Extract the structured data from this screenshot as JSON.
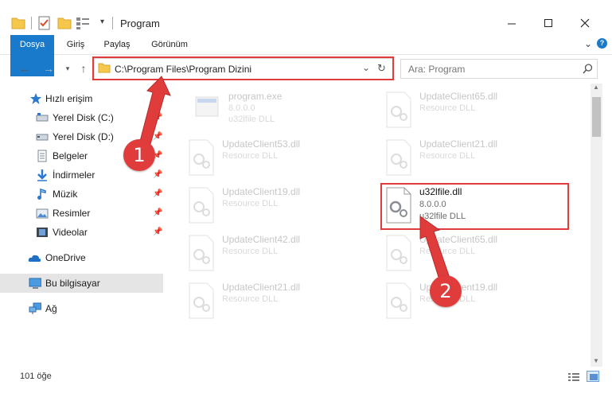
{
  "window": {
    "title": "Program"
  },
  "ribbon": {
    "tabs": [
      "Dosya",
      "Giriş",
      "Paylaş",
      "Görünüm"
    ]
  },
  "address": {
    "path": "C:\\Program Files\\Program Dizini"
  },
  "search": {
    "placeholder": "Ara: Program"
  },
  "sidebar": {
    "items": [
      {
        "label": "Hızlı erişim",
        "icon": "star-icon"
      },
      {
        "label": "Yerel Disk (C:)",
        "icon": "drive-icon"
      },
      {
        "label": "Yerel Disk (D:)",
        "icon": "drive-icon"
      },
      {
        "label": "Belgeler",
        "icon": "documents-icon"
      },
      {
        "label": "İndirmeler",
        "icon": "download-icon"
      },
      {
        "label": "Müzik",
        "icon": "music-icon"
      },
      {
        "label": "Resimler",
        "icon": "pictures-icon"
      },
      {
        "label": "Videolar",
        "icon": "videos-icon"
      },
      {
        "label": "OneDrive",
        "icon": "cloud-icon"
      },
      {
        "label": "Bu bilgisayar",
        "icon": "computer-icon"
      },
      {
        "label": "Ağ",
        "icon": "network-icon"
      }
    ]
  },
  "files": [
    {
      "name": "program.exe",
      "line2": "8.0.0.0",
      "line3": "u32lfile DLL",
      "highlighted": false
    },
    {
      "name": "UpdateClient65.dll",
      "line2": "Resource DLL",
      "line3": "",
      "highlighted": false
    },
    {
      "name": "UpdateClient53.dll",
      "line2": "Resource DLL",
      "line3": "",
      "highlighted": false
    },
    {
      "name": "UpdateClient21.dll",
      "line2": "Resource DLL",
      "line3": "",
      "highlighted": false
    },
    {
      "name": "UpdateClient19.dll",
      "line2": "Resource DLL",
      "line3": "",
      "highlighted": false
    },
    {
      "name": "u32lfile.dll",
      "line2": "8.0.0.0",
      "line3": "u32lfile DLL",
      "highlighted": true
    },
    {
      "name": "UpdateClient42.dll",
      "line2": "Resource DLL",
      "line3": "",
      "highlighted": false
    },
    {
      "name": "UpdateClient65.dll",
      "line2": "Resource DLL",
      "line3": "",
      "highlighted": false
    },
    {
      "name": "UpdateClient21.dll",
      "line2": "Resource DLL",
      "line3": "",
      "highlighted": false
    },
    {
      "name": "UpdateClient19.dll",
      "line2": "Resource DLL",
      "line3": "",
      "highlighted": false
    }
  ],
  "status": {
    "count": "101 öğe"
  },
  "annotations": {
    "badge1": "1",
    "badge2": "2"
  }
}
